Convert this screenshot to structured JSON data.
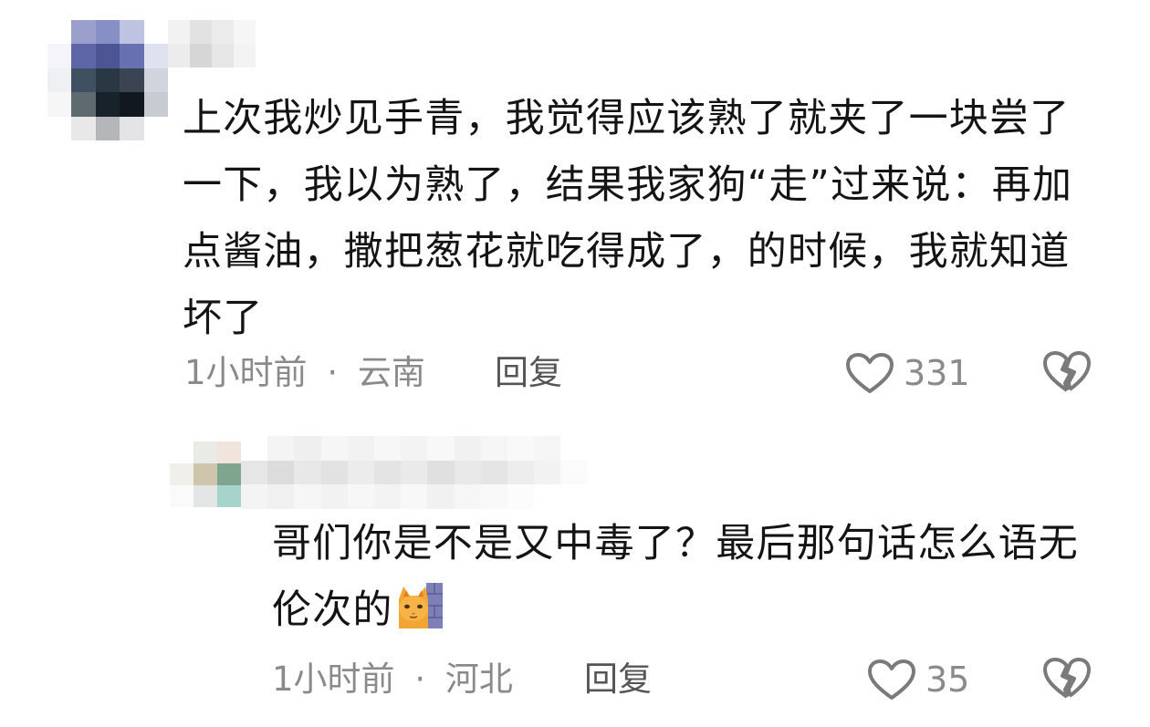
{
  "comments": [
    {
      "text": "上次我炒见手青，我觉得应该熟了就夹了一块尝了一下，我以为熟了，结果我家狗“走”过来说：再加点酱油，撒把葱花就吃得成了，的时候，我就知道坏了",
      "time": "1小时前",
      "separator": "·",
      "location": "云南",
      "reply_label": "回复",
      "likes": "331",
      "like_icon": "heart-outline-icon",
      "dislike_icon": "broken-heart-icon"
    },
    {
      "text": "哥们你是不是又中毒了？最后那句话怎么语无伦次的",
      "emoji": "cat-peeking-emoji",
      "time": "1小时前",
      "separator": "·",
      "location": "河北",
      "reply_label": "回复",
      "likes": "35",
      "like_icon": "heart-outline-icon",
      "dislike_icon": "broken-heart-icon"
    }
  ],
  "colors": {
    "text": "#141414",
    "meta": "#8a8a8a",
    "icon": "#7a7a7a",
    "background": "#ffffff"
  }
}
